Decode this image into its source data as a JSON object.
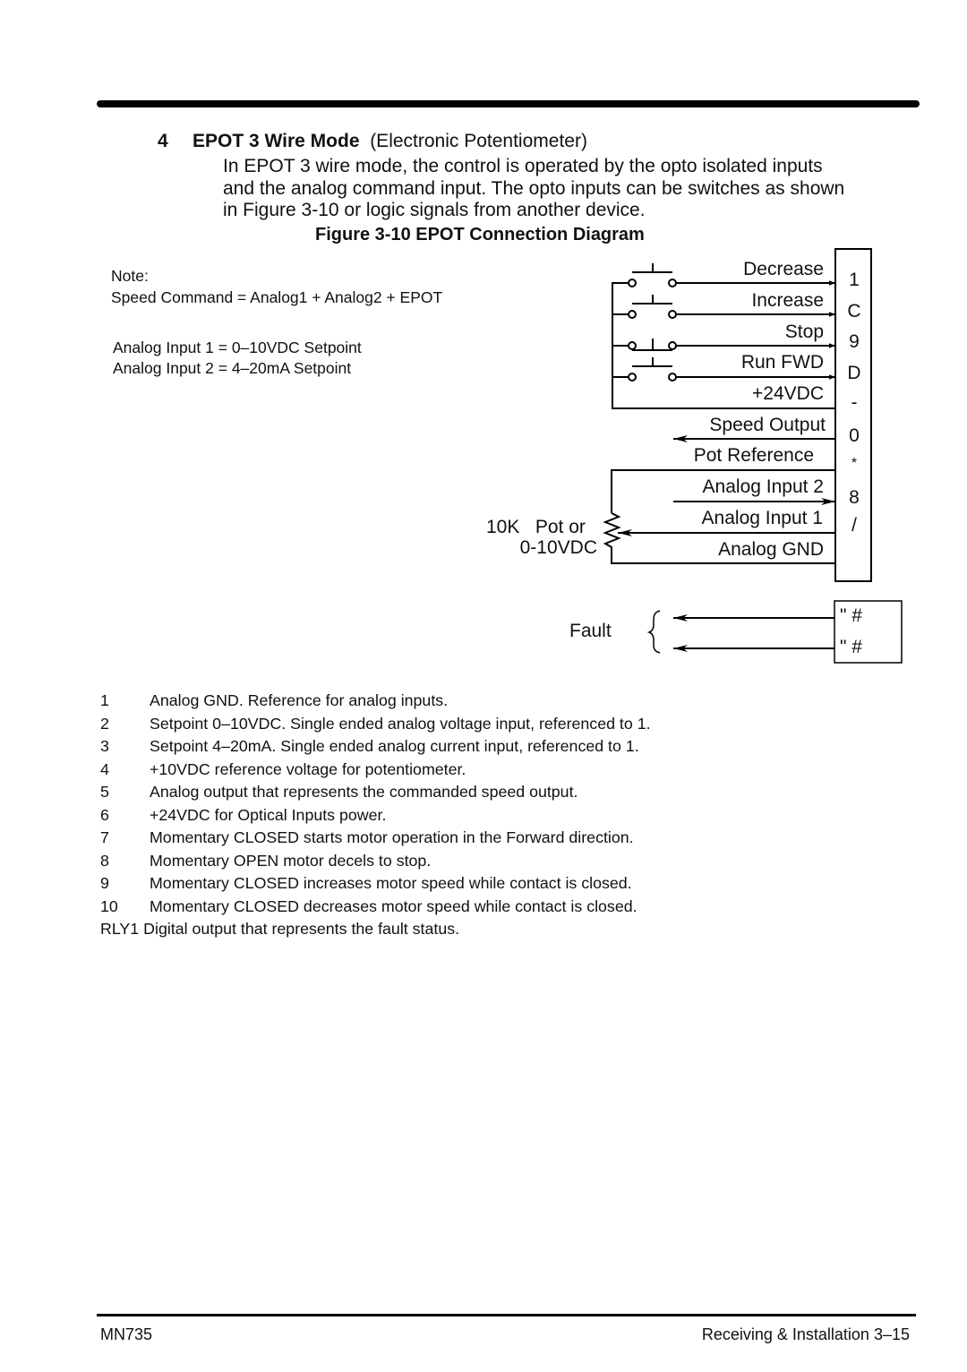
{
  "section": {
    "number": "4",
    "title_bold": "EPOT 3 Wire Mode",
    "title_rest": "(Electronic Potentiometer)",
    "paragraph_lines": [
      "In EPOT 3 wire mode, the control is operated by the opto isolated inputs",
      "and the analog command input.  The opto inputs can be switches as shown",
      "in Figure 3-10 or logic signals from another device."
    ]
  },
  "figure": {
    "title": "Figure 3-10  EPOT Connection Diagram",
    "note": {
      "heading": "Note:",
      "formula": "Speed Command =  Analog1 + Analog2 + EPOT",
      "input1": "Analog Input 1 = 0–10VDC Setpoint",
      "input2": "Analog Input 2 = 4–20mA Setpoint"
    },
    "signals": {
      "decrease": "Decrease",
      "increase": "Increase",
      "stop": "Stop",
      "run_fwd": "Run FWD",
      "plus24": "+24VDC",
      "speed_output": "Speed Output",
      "pot_reference": "Pot Reference",
      "analog_input_2": "Analog Input 2",
      "analog_input_1": "Analog Input 1",
      "analog_gnd": "Analog GND"
    },
    "pot_label_1": "10K   Pot or",
    "pot_label_2": "0-10VDC",
    "fault_label": "Fault",
    "terminal_glyphs": [
      "1",
      "C",
      "9",
      "D",
      "-",
      "0",
      "*",
      "8",
      "/"
    ],
    "relay_glyphs": [
      "\" #",
      "\" #"
    ]
  },
  "descriptions": [
    {
      "num": "1",
      "text": "Analog GND. Reference for analog inputs."
    },
    {
      "num": "2",
      "text": "Setpoint 0–10VDC. Single ended analog voltage input, referenced to 1."
    },
    {
      "num": "3",
      "text": "Setpoint 4–20mA. Single ended analog current input, referenced to 1."
    },
    {
      "num": "4",
      "text": "+10VDC reference voltage for potentiometer."
    },
    {
      "num": "5",
      "text": "Analog output that represents the commanded speed output."
    },
    {
      "num": "6",
      "text": "+24VDC for Optical Inputs power."
    },
    {
      "num": "7",
      "text": "Momentary CLOSED starts motor operation in the Forward direction."
    },
    {
      "num": "8",
      "text": "Momentary OPEN motor decels to stop."
    },
    {
      "num": "9",
      "text": "Momentary CLOSED increases motor speed while contact is closed."
    },
    {
      "num": "10",
      "text": "Momentary CLOSED decreases motor speed while contact is closed."
    },
    {
      "num": "RLY1",
      "text": "Digital output that represents the fault status."
    }
  ],
  "footer": {
    "left": "MN735",
    "right": "Receiving & Installation 3–15"
  }
}
